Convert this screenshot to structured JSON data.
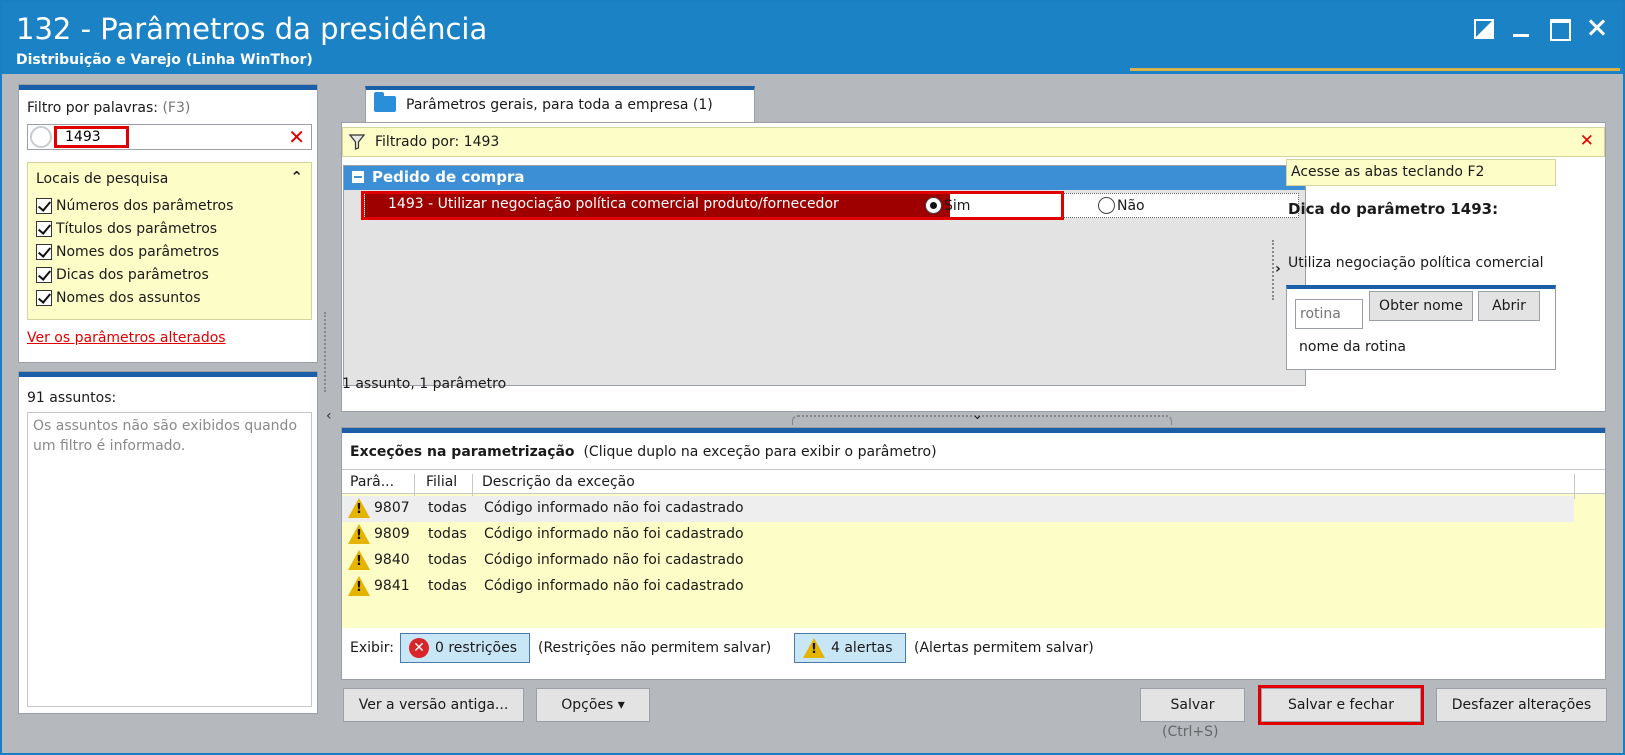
{
  "window": {
    "title": "132 - Parâmetros da presidência",
    "subtitle": "Distribuição e Varejo (Linha WinThor)"
  },
  "filter": {
    "label": "Filtro por palavras:",
    "shortcut": "(F3)",
    "value": "1493",
    "clear": "✕"
  },
  "locais": {
    "title": "Locais de pesquisa",
    "collapse": "⌃",
    "items": [
      "Números dos parâmetros",
      "Títulos dos parâmetros",
      "Nomes dos parâmetros",
      "Dicas dos parâmetros",
      "Nomes dos assuntos"
    ]
  },
  "altered_link": "Ver os parâmetros alterados",
  "assuntos": {
    "title": "91 assuntos:",
    "message": "Os assuntos não são exibidos quando um filtro é informado."
  },
  "tab": {
    "label": "Parâmetros gerais, para toda a empresa  (1)"
  },
  "filter_bar": {
    "text": "Filtrado por: 1493",
    "close": "✕"
  },
  "group": {
    "title": "Pedido de compra",
    "param_label": "1493 - Utilizar negociação política comercial produto/fornecedor",
    "option_yes": "Sim",
    "option_no": "Não",
    "selected": "Sim"
  },
  "count_text": "1 assunto, 1 parâmetro",
  "hint": {
    "f2": "Acesse as abas teclando F2",
    "title": "Dica do parâmetro 1493:",
    "text": "Utiliza negociação política comercial"
  },
  "rotina": {
    "placeholder": "rotina",
    "get_name": "Obter nome",
    "open": "Abrir",
    "caption": "nome da rotina"
  },
  "exceptions": {
    "title": "Exceções na parametrização",
    "subtitle": "(Clique duplo na exceção para exibir o parâmetro)",
    "columns": [
      "Parâ...",
      "Filial",
      "Descrição da exceção"
    ],
    "rows": [
      {
        "param": "9807",
        "filial": "todas",
        "desc": "Código informado não foi cadastrado"
      },
      {
        "param": "9809",
        "filial": "todas",
        "desc": "Código informado não foi cadastrado"
      },
      {
        "param": "9840",
        "filial": "todas",
        "desc": "Código informado não foi cadastrado"
      },
      {
        "param": "9841",
        "filial": "todas",
        "desc": "Código informado não foi cadastrado"
      }
    ],
    "show_label": "Exibir:",
    "restrictions": "0 restrições",
    "restrictions_note": "(Restrições não permitem salvar)",
    "alerts": "4 alertas",
    "alerts_note": "(Alertas permitem salvar)"
  },
  "footer": {
    "old_version": "Ver a versão antiga...",
    "options": "Opções ▾",
    "save": "Salvar",
    "save_shortcut": "(Ctrl+S)",
    "save_close": "Salvar e fechar",
    "undo": "Desfazer alterações"
  },
  "colors": {
    "titlebar": "#1b82c6",
    "highlight_red": "#e00000",
    "param_selected": "#9e0000",
    "group_header": "#3c8fd4",
    "yellow_bg": "#fdfdc8"
  }
}
